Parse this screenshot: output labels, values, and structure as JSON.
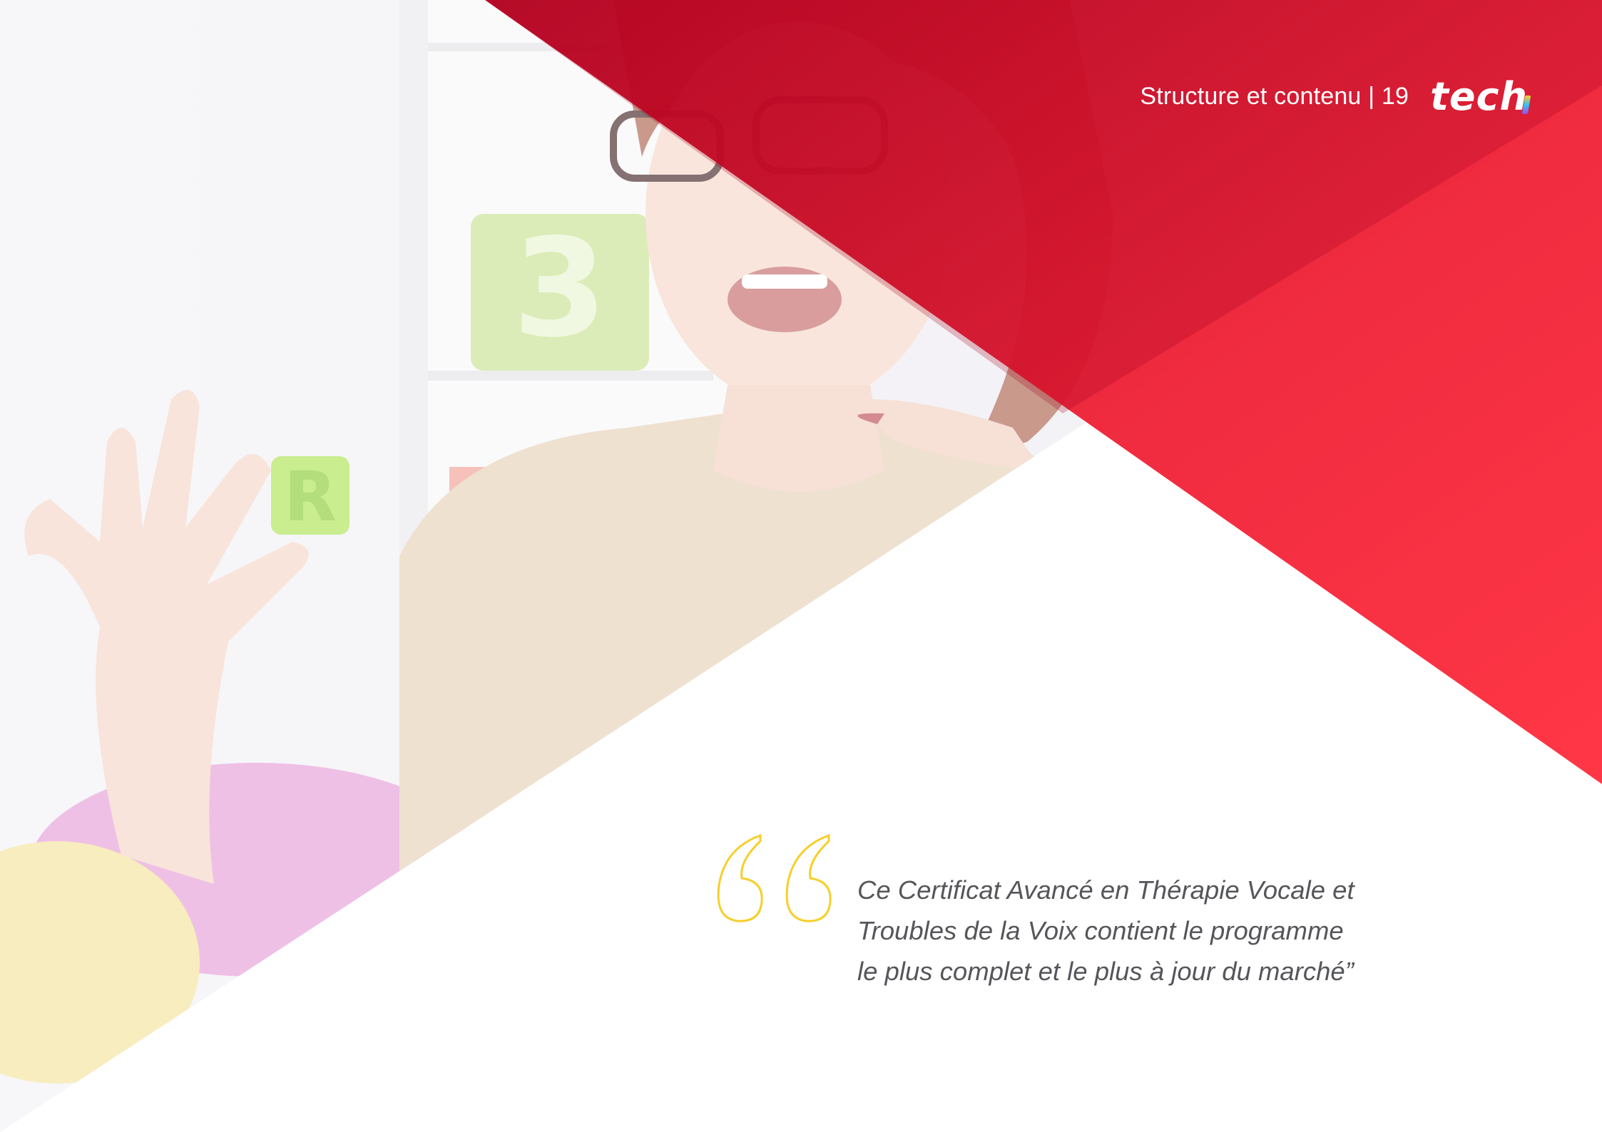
{
  "header": {
    "section": "Structure et contenu",
    "separator": " | ",
    "page_number": "19"
  },
  "logo": {
    "text": "tec",
    "last_letter": "h"
  },
  "photo": {
    "description_icon": "photo-therapist-holding-letter-r-icon",
    "letter_block": "R",
    "number_block": "3"
  },
  "quote": {
    "line1": "Ce Certificat Avancé en Thérapie Vocale et",
    "line2": "Troubles de la Voix contient le programme",
    "line3": "le plus complet et le plus à jour du marché”"
  },
  "colors": {
    "brand_red": "#ff2a3a",
    "dark_red": "#c8001c",
    "quote_mark_yellow": "#f6cf2b",
    "text_gray": "#55565a"
  }
}
